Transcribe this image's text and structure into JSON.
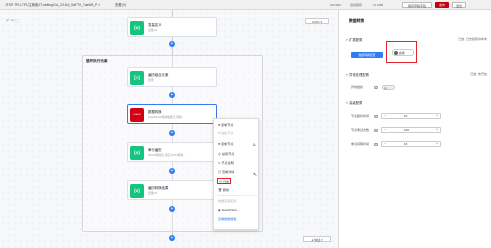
{
  "titlebar": {
    "app_tab": "JTSP-TPU-TPU主管组/IT-setting/CA_23.8.6_SaFT0_7aaW5_P",
    "close_glyph": "×",
    "version_label": "查看(V)",
    "status_items": [
      "20/1000",
      "自动保存",
      "11.1MB"
    ],
    "buttons": {
      "outline1": "保存草稿字段",
      "primary": "发布",
      "outline2": "退出"
    }
  },
  "canvas": {
    "undo_redo": "↶ ↷ ⬚",
    "zoom": "100% ▾",
    "group_title": "循环执行元素",
    "nodes": [
      {
        "title": "变量定义",
        "subtitle": "变量V2",
        "icon": "{x}"
      },
      {
        "title": "遍历组合元素",
        "subtitle": "结果",
        "icon": "[≡]"
      },
      {
        "title": "数据转换",
        "subtitle": "SparkPack转换数据元 转换...",
        "icon": "HUAWEI"
      },
      {
        "title": "串行遍历",
        "subtitle": "JSON转成表 对应JSON转换...",
        "icon": "{x}"
      },
      {
        "title": "遍历转换结果",
        "subtitle": "变量V2",
        "icon": "{x}"
      }
    ],
    "bottom_select": "● 快捷 ▾"
  },
  "context_menu": {
    "items": [
      "复制节点",
      "粘贴节点",
      "复制节点",
      "禁用节点",
      "节点说明",
      "查看详情",
      "日志",
      "删除"
    ],
    "dim_items": [
      false,
      true,
      false,
      false,
      false,
      false,
      false,
      false
    ],
    "highlighted_index": 6,
    "section_label": "数据来源配置",
    "source_items": [
      "SparkPack...",
      "查看数据模板"
    ],
    "side_icon": "⧉"
  },
  "panel": {
    "title": "数据转换",
    "section1": {
      "label": "扩展配置",
      "note": "已启, 日志级别请参考",
      "button": "数据转换配置",
      "toggle_label": "启用"
    },
    "section2": {
      "label": "异常处理配置",
      "note": "已启, 未开启",
      "row_label": "异常继续"
    },
    "section3": {
      "label": "高级配置"
    },
    "fields": [
      {
        "label": "节点超时时间",
        "value": "10"
      },
      {
        "label": "节点重试次数",
        "value": "100"
      },
      {
        "label": "重试间隔时间",
        "value": "15"
      }
    ],
    "minus": "−",
    "plus": "+",
    "question": "?"
  },
  "colors": {
    "accent": "#2f7cf6",
    "primary_red": "#c7000b",
    "highlight": "#e0262f",
    "node_icon": "#15c47e"
  }
}
